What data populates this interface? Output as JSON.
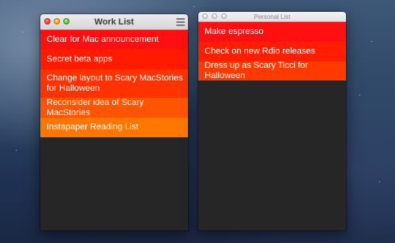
{
  "desktop": {
    "colors": {
      "sky_top": "#3e5877",
      "sky_bottom": "#1a2844"
    }
  },
  "work_window": {
    "title": "Work List",
    "menu_icon": "hamburger-menu-icon",
    "items": [
      {
        "label": "Clear for Mac announcement",
        "color": "#ff0f0f"
      },
      {
        "label": "Secret beta apps",
        "color": "#ff1a00"
      },
      {
        "label": "Change layout to Scary MacStories for Halloween",
        "color": "#ff3300"
      },
      {
        "label": "Reconsider idea of Scary MacStories",
        "color": "#ff5500"
      },
      {
        "label": "Instapaper Reading List",
        "color": "#ff7700"
      }
    ],
    "background": "#262626"
  },
  "personal_window": {
    "title": "Personal List",
    "items": [
      {
        "label": "Make espresso",
        "color": "#ff0f0f"
      },
      {
        "label": "Check on new Rdio releases",
        "color": "#ff1e00"
      },
      {
        "label": "Dress up as Scary Ticci for Halloween",
        "color": "#ff3a00"
      }
    ],
    "background": "#262626"
  }
}
